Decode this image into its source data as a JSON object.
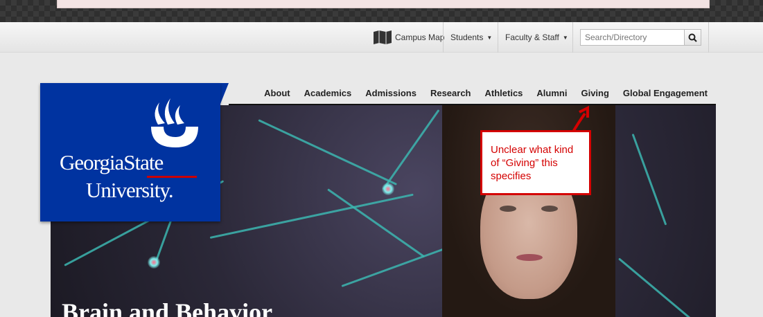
{
  "utility": {
    "campus_map": "Campus Map",
    "students": "Students",
    "faculty_staff": "Faculty & Staff",
    "search_placeholder": "Search/Directory"
  },
  "nav": {
    "items": [
      "About",
      "Academics",
      "Admissions",
      "Research",
      "Athletics",
      "Alumni",
      "Giving",
      "Global Engagement"
    ]
  },
  "logo": {
    "line1": "GeorgiaState",
    "line2": "University."
  },
  "hero": {
    "title": "Brain and Behavior"
  },
  "annotation": {
    "text": "Unclear what kind of “Giving” this specifies"
  },
  "colors": {
    "brand_blue": "#0033a0",
    "annotation_red": "#d40000"
  }
}
